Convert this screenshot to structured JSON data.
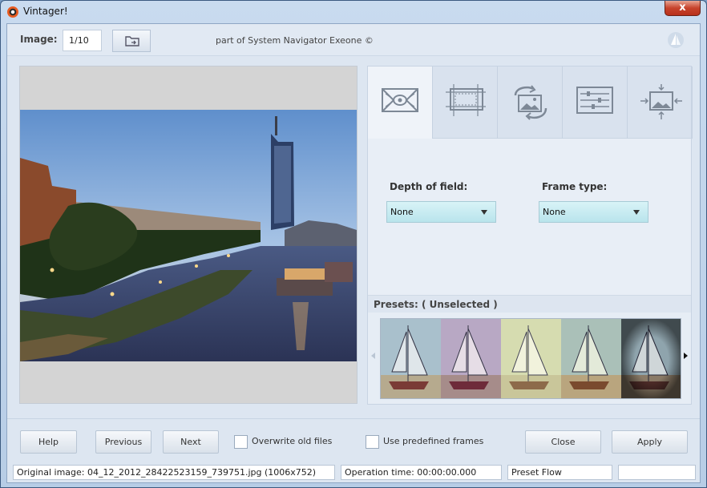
{
  "window": {
    "title": "Vintager!",
    "close_glyph": "x"
  },
  "toolbar": {
    "image_label": "Image:",
    "image_counter": "1/10",
    "credit": "part of System Navigator Exeone ©"
  },
  "tabs": [
    {
      "name": "depth-of-field",
      "icon": "vignette-icon",
      "active": true
    },
    {
      "name": "crop",
      "icon": "crop-icon",
      "active": false
    },
    {
      "name": "rotate",
      "icon": "rotate-image-icon",
      "active": false
    },
    {
      "name": "adjust",
      "icon": "sliders-icon",
      "active": false
    },
    {
      "name": "resize",
      "icon": "resize-image-icon",
      "active": false
    }
  ],
  "settings": {
    "depth_label": "Depth of field:",
    "depth_value": "None",
    "frame_label": "Frame type:",
    "frame_value": "None"
  },
  "presets": {
    "label": "Presets: ( Unselected )",
    "thumbnails": [
      {
        "tone": "cool"
      },
      {
        "tone": "magenta"
      },
      {
        "tone": "yellow-faded"
      },
      {
        "tone": "warm-green"
      },
      {
        "tone": "dark-vignette"
      }
    ]
  },
  "buttons": {
    "help": "Help",
    "previous": "Previous",
    "next": "Next",
    "close": "Close",
    "apply": "Apply"
  },
  "options": {
    "overwrite_label": "Overwrite old files",
    "overwrite_checked": false,
    "frames_label": "Use predefined frames",
    "frames_checked": false
  },
  "status": {
    "original_image": "Original image: 04_12_2012_28422523159_739751.jpg (1006x752)",
    "operation_time": "Operation time: 00:00:00.000",
    "mode": "Preset Flow",
    "extra": ""
  },
  "colors": {
    "accent_dropdown": "#c4ebf1",
    "close_red": "#c7432c",
    "panel": "#e8eef6"
  }
}
